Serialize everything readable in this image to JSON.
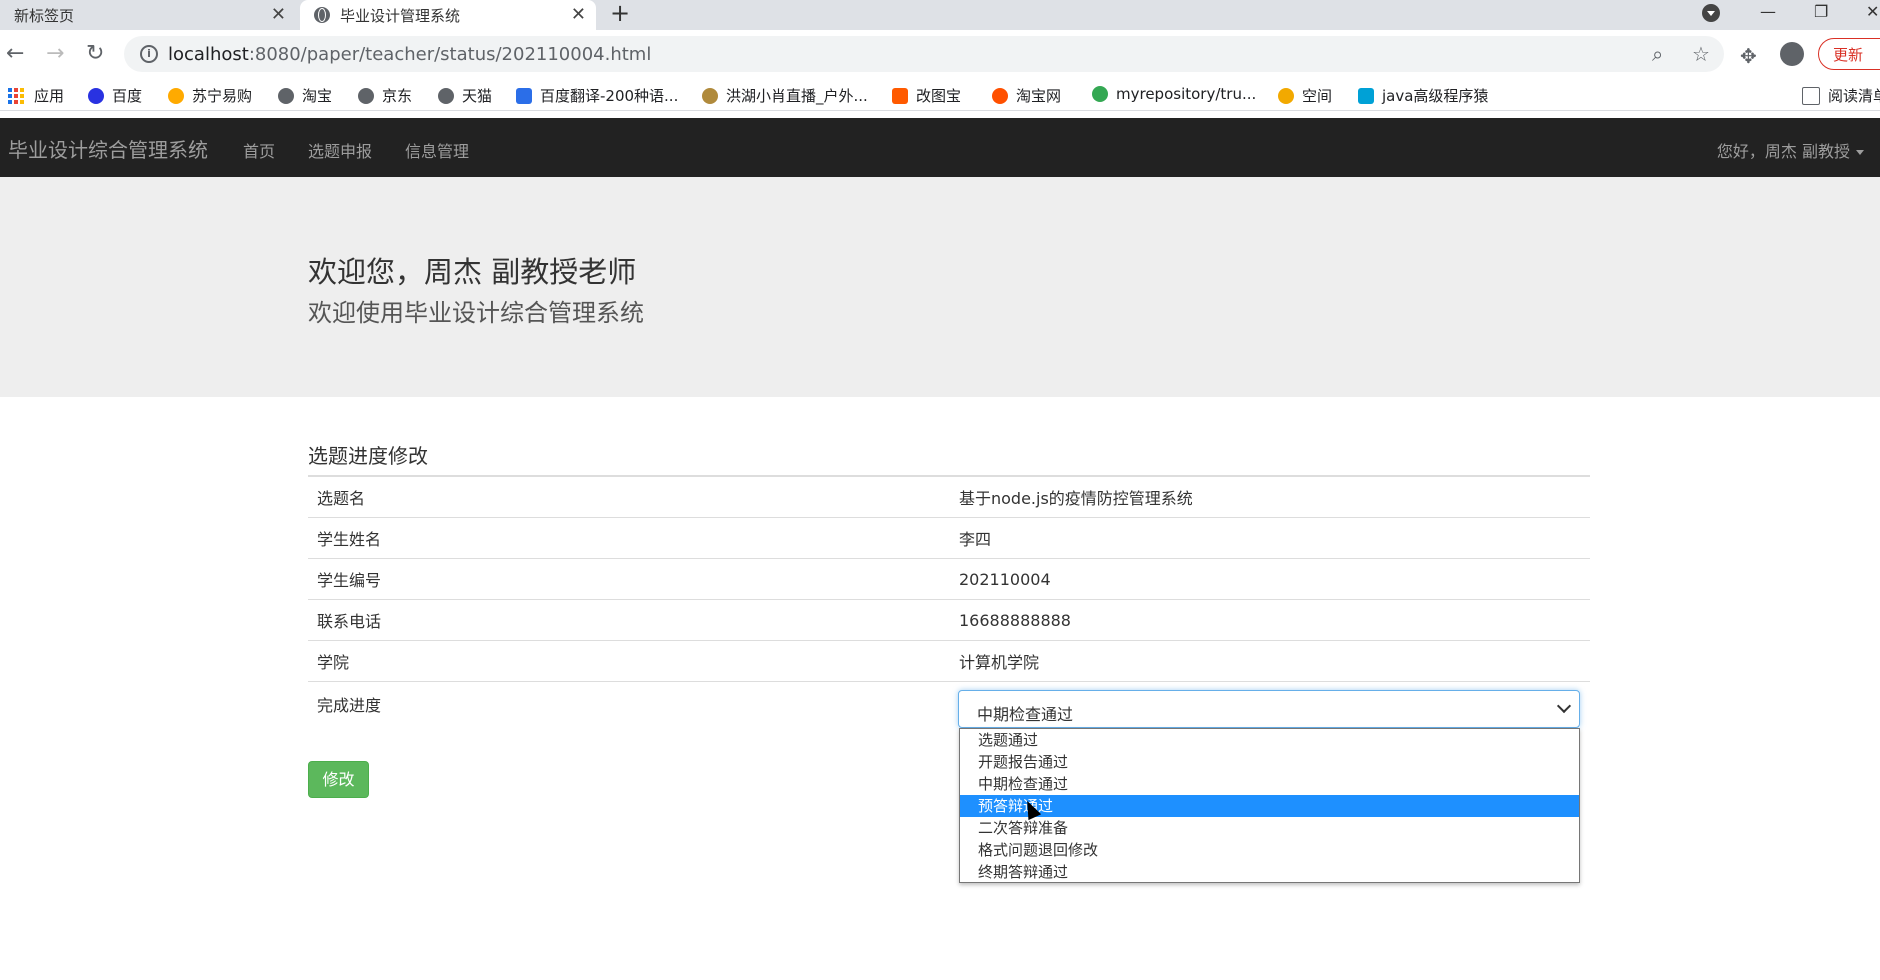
{
  "browser": {
    "tabs": [
      {
        "label": "新标签页",
        "active": false
      },
      {
        "label": "毕业设计管理系统",
        "active": true
      }
    ],
    "url_host": "localhost",
    "url_rest": ":8080/paper/teacher/status/202110004.html",
    "update_label": "更新",
    "bookmarks": [
      {
        "label": "应用",
        "icon": "apps-grid-icon"
      },
      {
        "label": "百度",
        "icon": "baidu-paw-icon",
        "color": "#2932e1"
      },
      {
        "label": "苏宁易购",
        "icon": "suning-icon",
        "color": "#ffaa00"
      },
      {
        "label": "淘宝",
        "icon": "globe-icon",
        "color": "#5f6368"
      },
      {
        "label": "京东",
        "icon": "globe-icon",
        "color": "#5f6368"
      },
      {
        "label": "天猫",
        "icon": "globe-icon",
        "color": "#5f6368"
      },
      {
        "label": "百度翻译-200种语...",
        "icon": "translate-icon",
        "color": "#2b6ee8"
      },
      {
        "label": "洪湖小肖直播_户外...",
        "icon": "bird-icon",
        "color": "#b08a3c"
      },
      {
        "label": "改图宝",
        "icon": "gaitubao-icon",
        "color": "#ff5a00"
      },
      {
        "label": "淘宝网",
        "icon": "taobao-icon",
        "color": "#ff5000"
      },
      {
        "label": "myrepository/tru...",
        "icon": "chrome-icon",
        "color": "#34a853"
      },
      {
        "label": "空间",
        "icon": "qzone-icon",
        "color": "#f2a900"
      },
      {
        "label": "java高级程序猿",
        "icon": "bilibili-icon",
        "color": "#00a1d6"
      }
    ],
    "reading_list_label": "阅读清单"
  },
  "navbar": {
    "brand": "毕业设计综合管理系统",
    "links": [
      "首页",
      "选题申报",
      "信息管理"
    ],
    "user": "您好，周杰 副教授"
  },
  "jumbotron": {
    "title": "欢迎您，周杰 副教授老师",
    "subtitle": "欢迎使用毕业设计综合管理系统"
  },
  "form": {
    "heading": "选题进度修改",
    "rows": [
      {
        "label": "选题名",
        "value": "基于node.js的疫情防控管理系统"
      },
      {
        "label": "学生姓名",
        "value": "李四"
      },
      {
        "label": "学生编号",
        "value": "202110004"
      },
      {
        "label": "联系电话",
        "value": "16688888888"
      },
      {
        "label": "学院",
        "value": "计算机学院"
      },
      {
        "label": "完成进度",
        "value": ""
      }
    ],
    "progress_selected": "中期检查通过",
    "progress_options": [
      "选题通过",
      "开题报告通过",
      "中期检查通过",
      "预答辩通过",
      "二次答辩准备",
      "格式问题退回修改",
      "终期答辩通过"
    ],
    "highlighted_option": "预答辩通过",
    "submit_label": "修改"
  }
}
